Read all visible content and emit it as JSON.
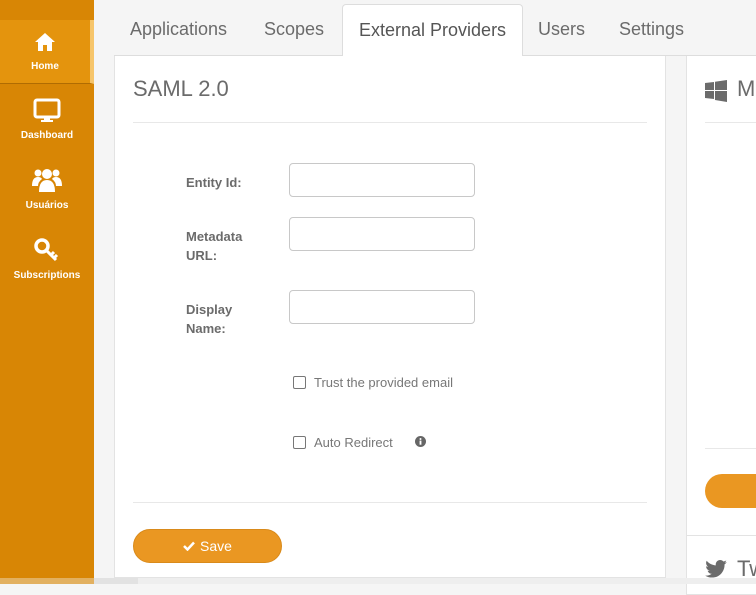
{
  "sidebar": {
    "items": [
      {
        "label": "Home",
        "icon": "home-icon",
        "active": true
      },
      {
        "label": "Dashboard",
        "icon": "monitor-icon",
        "active": false
      },
      {
        "label": "Usuários",
        "icon": "users-icon",
        "active": false
      },
      {
        "label": "Subscriptions",
        "icon": "key-icon",
        "active": false
      }
    ]
  },
  "tabs": [
    {
      "label": "Applications",
      "active": false
    },
    {
      "label": "Scopes",
      "active": false
    },
    {
      "label": "External Providers",
      "active": true
    },
    {
      "label": "Users",
      "active": false
    },
    {
      "label": "Settings",
      "active": false
    }
  ],
  "saml_panel": {
    "title": "SAML 2.0",
    "fields": [
      {
        "label_line1": "Entity Id:",
        "label_line2": "",
        "value": "",
        "placeholder": ""
      },
      {
        "label_line1": "Metadata",
        "label_line2": "URL:",
        "value": "",
        "placeholder": ""
      },
      {
        "label_line1": "Display",
        "label_line2": "Name:",
        "value": "",
        "placeholder": ""
      }
    ],
    "checkboxes": [
      {
        "label": "Trust the provided email",
        "checked": false
      },
      {
        "label": "Auto Redirect",
        "checked": false,
        "info_icon": "info-circle-icon"
      }
    ],
    "save_label": "Save"
  },
  "right_panels": [
    {
      "title": "M",
      "icon": "windows-icon"
    },
    {
      "title": "Tw",
      "icon": "twitter-icon"
    }
  ],
  "colors": {
    "sidebar": "#d88605",
    "sidebar_active": "#e4940d",
    "accent": "#ea9722"
  }
}
